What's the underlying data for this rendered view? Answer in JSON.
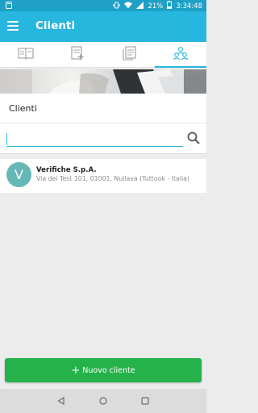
{
  "status_bar": {
    "battery_percent": "21%",
    "time": "3:34:48"
  },
  "app_bar": {
    "title": "Clienti"
  },
  "tabs": [
    {
      "icon": "book-icon",
      "active": false
    },
    {
      "icon": "new-document-icon",
      "active": false
    },
    {
      "icon": "documents-icon",
      "active": false
    },
    {
      "icon": "clients-icon",
      "active": true
    }
  ],
  "section": {
    "title": "Clienti"
  },
  "search": {
    "value": "",
    "placeholder": ""
  },
  "clients": [
    {
      "initial": "V",
      "name": "Verifiche S.p.A.",
      "address": "Via dei Test 101, 01001, Nullava (Tuttook - Italia)"
    }
  ],
  "actions": {
    "add_client_label": "Nuovo cliente"
  },
  "colors": {
    "app_bar": "#27b6dd",
    "status_bar": "#1ea0c7",
    "avatar": "#66b8b6",
    "add_button": "#25b24b"
  }
}
